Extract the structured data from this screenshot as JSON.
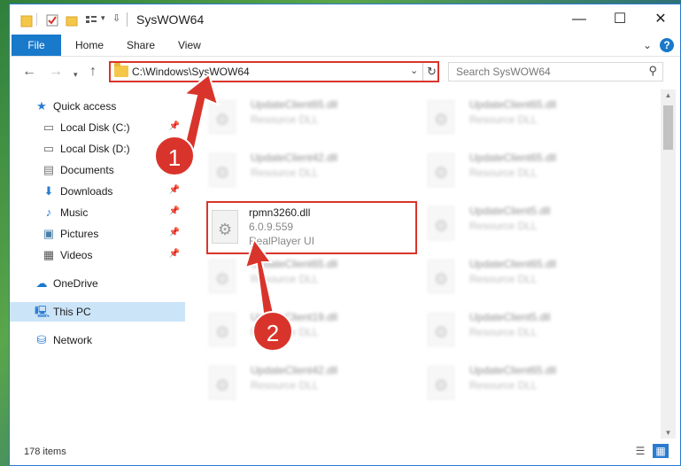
{
  "window": {
    "title": "SysWOW64",
    "controls": [
      "minimize",
      "maximize",
      "close"
    ]
  },
  "ribbon": {
    "tabs": [
      "File",
      "Home",
      "Share",
      "View"
    ]
  },
  "address": {
    "path": "C:\\Windows\\SysWOW64"
  },
  "search": {
    "placeholder": "Search SysWOW64"
  },
  "sidebar": {
    "items": [
      {
        "label": "Quick access",
        "icon": "star-icon"
      },
      {
        "label": "Local Disk (C:)",
        "icon": "drive-icon"
      },
      {
        "label": "Local Disk (D:)",
        "icon": "drive-icon"
      },
      {
        "label": "Documents",
        "icon": "documents-icon"
      },
      {
        "label": "Downloads",
        "icon": "download-icon"
      },
      {
        "label": "Music",
        "icon": "music-icon"
      },
      {
        "label": "Pictures",
        "icon": "pictures-icon"
      },
      {
        "label": "Videos",
        "icon": "videos-icon"
      },
      {
        "label": "OneDrive",
        "icon": "cloud-icon"
      },
      {
        "label": "This PC",
        "icon": "computer-icon"
      },
      {
        "label": "Network",
        "icon": "network-icon"
      }
    ]
  },
  "files": [
    {
      "name": "UpdateClient65.dll",
      "type": "Resource DLL"
    },
    {
      "name": "UpdateClient65.dll",
      "type": "Resource DLL"
    },
    {
      "name": "UpdateClient42.dll",
      "type": "Resource DLL"
    },
    {
      "name": "UpdateClient65.dll",
      "type": "Resource DLL"
    },
    {
      "name": "rpmn3260.dll",
      "version": "6.0.9.559",
      "type": "RealPlayer UI"
    },
    {
      "name": "UpdateClient5.dll",
      "type": "Resource DLL"
    },
    {
      "name": "UpdateClient65.dll",
      "type": "Resource DLL"
    },
    {
      "name": "UpdateClient65.dll",
      "type": "Resource DLL"
    },
    {
      "name": "UpdateClient19.dll",
      "type": "Resource DLL"
    },
    {
      "name": "UpdateClient5.dll",
      "type": "Resource DLL"
    },
    {
      "name": "UpdateClient42.dll",
      "type": "Resource DLL"
    },
    {
      "name": "UpdateClient65.dll",
      "type": "Resource DLL"
    }
  ],
  "status": {
    "item_count": "178 items"
  },
  "annotations": {
    "step1": "1",
    "step2": "2"
  },
  "colors": {
    "accent": "#1979ca",
    "highlight": "#d9342b",
    "selected": "#cce4f7"
  }
}
